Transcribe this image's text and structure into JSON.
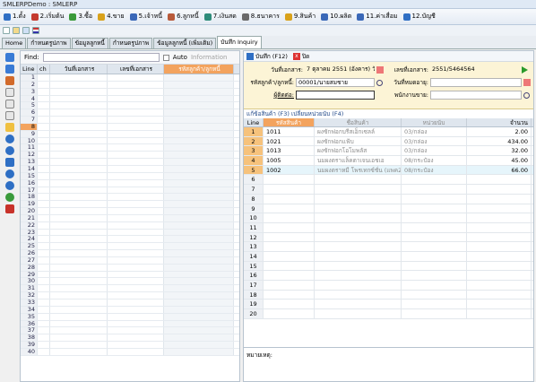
{
  "window": {
    "title": "SMLERPDemo : SMLERP"
  },
  "menu": [
    {
      "label": "1.ตั้ง",
      "icon": "setup-icon",
      "color": "#2f6fc4"
    },
    {
      "label": "2.เริ่มต้น",
      "icon": "start-icon",
      "color": "#c43a2f"
    },
    {
      "label": "3.ซื้อ",
      "icon": "purchase-icon",
      "color": "#3a9a3a"
    },
    {
      "label": "4.ขาย",
      "icon": "sale-icon",
      "color": "#d9a21b"
    },
    {
      "label": "5.เจ้าหนี้",
      "icon": "creditor-icon",
      "color": "#3a68b8"
    },
    {
      "label": "6.ลูกหนี้",
      "icon": "debtor-icon",
      "color": "#b85a3a"
    },
    {
      "label": "7.เงินสด",
      "icon": "cash-icon",
      "color": "#2f8c7a"
    },
    {
      "label": "8.ธนาคาร",
      "icon": "bank-icon",
      "color": "#6a6a6a"
    },
    {
      "label": "9.สินค้า",
      "icon": "product-icon",
      "color": "#d9a21b"
    },
    {
      "label": "10.ผลิต",
      "icon": "production-icon",
      "color": "#3a68b8"
    },
    {
      "label": "11.ค่าเสื่อม",
      "icon": "depreciation-icon",
      "color": "#3a68b8"
    },
    {
      "label": "12.บัญชี",
      "icon": "account-icon",
      "color": "#2f6fc4"
    }
  ],
  "tabs": [
    {
      "label": "Home",
      "active": false
    },
    {
      "label": "กำหนดรูปภาพ",
      "active": false
    },
    {
      "label": "ข้อมูลลูกหนี้",
      "active": false
    },
    {
      "label": "กำหนดรูปภาพ",
      "active": false
    },
    {
      "label": "ข้อมูลลูกหนี้ (เพิ่มเติม)",
      "active": false
    },
    {
      "label": "บันทึก Inquiry",
      "active": true
    }
  ],
  "left": {
    "find_label": "Find:",
    "auto_label": "Auto",
    "information_label": "Information",
    "columns": [
      "Line",
      "ch",
      "วันที่เอกสาร",
      "เลขที่เอกสาร",
      "รหัสลูกค้า/ลูกหนี้"
    ],
    "highlight_row": 8,
    "row_count": 40
  },
  "right": {
    "save_label": "บันทึก (F12)",
    "close_label": "ปิด",
    "form": {
      "doc_date_label": "วันที่เอกสาร:",
      "doc_date_value": "7 ตุลาคม 2551 (อังคาร) วันอ",
      "doc_no_label": "เลขที่เอกสาร:",
      "doc_no_value": "2551/5464564",
      "customer_label": "รหัสลูกค้า/ลูกหนี้:",
      "customer_value": "00001/นายสมชาย",
      "due_date_label": "วันที่หมดอายุ:",
      "due_date_value": "",
      "contact_label": "ผู้ติดต่อ:",
      "contact_value": "",
      "salesperson_label": "พนักงานขาย:",
      "salesperson_value": ""
    },
    "subtabs_text": "แก้ข้อสินค้า (F3)    เปลี่ยนหน่วยนับ (F4)",
    "columns": [
      "Line",
      "รหัสสินค้า",
      "ชื่อสินค้า",
      "หน่วยนับ",
      "จำนวน"
    ],
    "items": [
      {
        "line": "1",
        "code": "1011",
        "name": "ผงซักฟอกบรีสเอ็กเซลล์",
        "unit": "03/กล่อง",
        "qty": "2.00"
      },
      {
        "line": "2",
        "code": "1021",
        "name": "ผงซักฟอกแฟ้บ",
        "unit": "03/กล่อง",
        "qty": "434.00"
      },
      {
        "line": "3",
        "code": "1013",
        "name": "ผงซักฟอกโอโมพลัส",
        "unit": "03/กล่อง",
        "qty": "32.00"
      },
      {
        "line": "4",
        "code": "1005",
        "name": "นมผงตราแล็คตาเจนเอชเอ",
        "unit": "08/กระป๋อง",
        "qty": "45.00"
      },
      {
        "line": "5",
        "code": "1002",
        "name": "นมผงตราหมี โพรเทกซ์ชั่น (แพค2ขั้น)",
        "unit": "08/กระป๋อง",
        "qty": "66.00"
      }
    ],
    "row_count": 20,
    "remark_label": "หมายเหตุ:"
  }
}
